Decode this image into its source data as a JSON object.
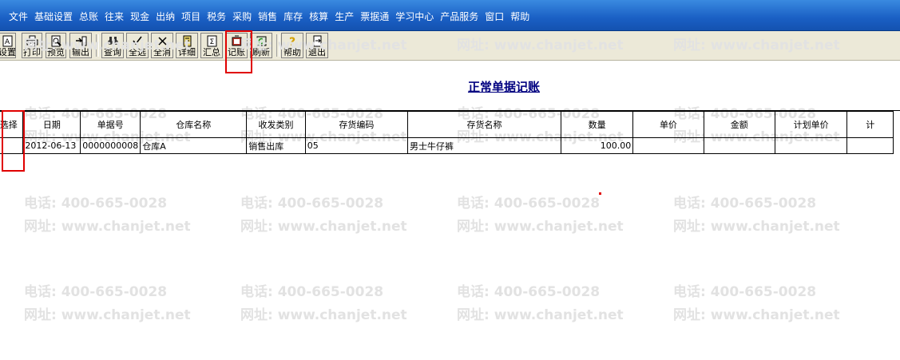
{
  "menu": [
    "文件",
    "基础设置",
    "总账",
    "往来",
    "现金",
    "出纳",
    "项目",
    "税务",
    "采购",
    "销售",
    "库存",
    "核算",
    "生产",
    "票据通",
    "学习中心",
    "产品服务",
    "窗口",
    "帮助"
  ],
  "toolbar": {
    "setup": "设置",
    "print": "打印",
    "preview": "预览",
    "export": "输出",
    "query": "查询",
    "select_all": "全选",
    "deselect_all": "全消",
    "detail": "详细",
    "summary": "汇总",
    "post": "记账",
    "refresh": "刷新",
    "help": "帮助",
    "exit": "退出"
  },
  "watermark": {
    "phone": "电话: 400-665-0028",
    "site": "网址: www.chanjet.net"
  },
  "page": {
    "title": "正常单据记账"
  },
  "table": {
    "columns": [
      "选择",
      "日期",
      "单据号",
      "仓库名称",
      "收发类别",
      "存货编码",
      "存货名称",
      "数量",
      "单价",
      "金额",
      "计划单价",
      "计"
    ],
    "rows": [
      [
        "",
        "2012-06-13",
        "0000000008",
        "仓库A",
        "销售出库",
        "05",
        "男士牛仔裤",
        "100.00",
        "",
        "",
        "",
        ""
      ]
    ]
  },
  "colors": {
    "menubar": "#1a5fc4",
    "title": "#000080",
    "highlight": "#e00000"
  }
}
